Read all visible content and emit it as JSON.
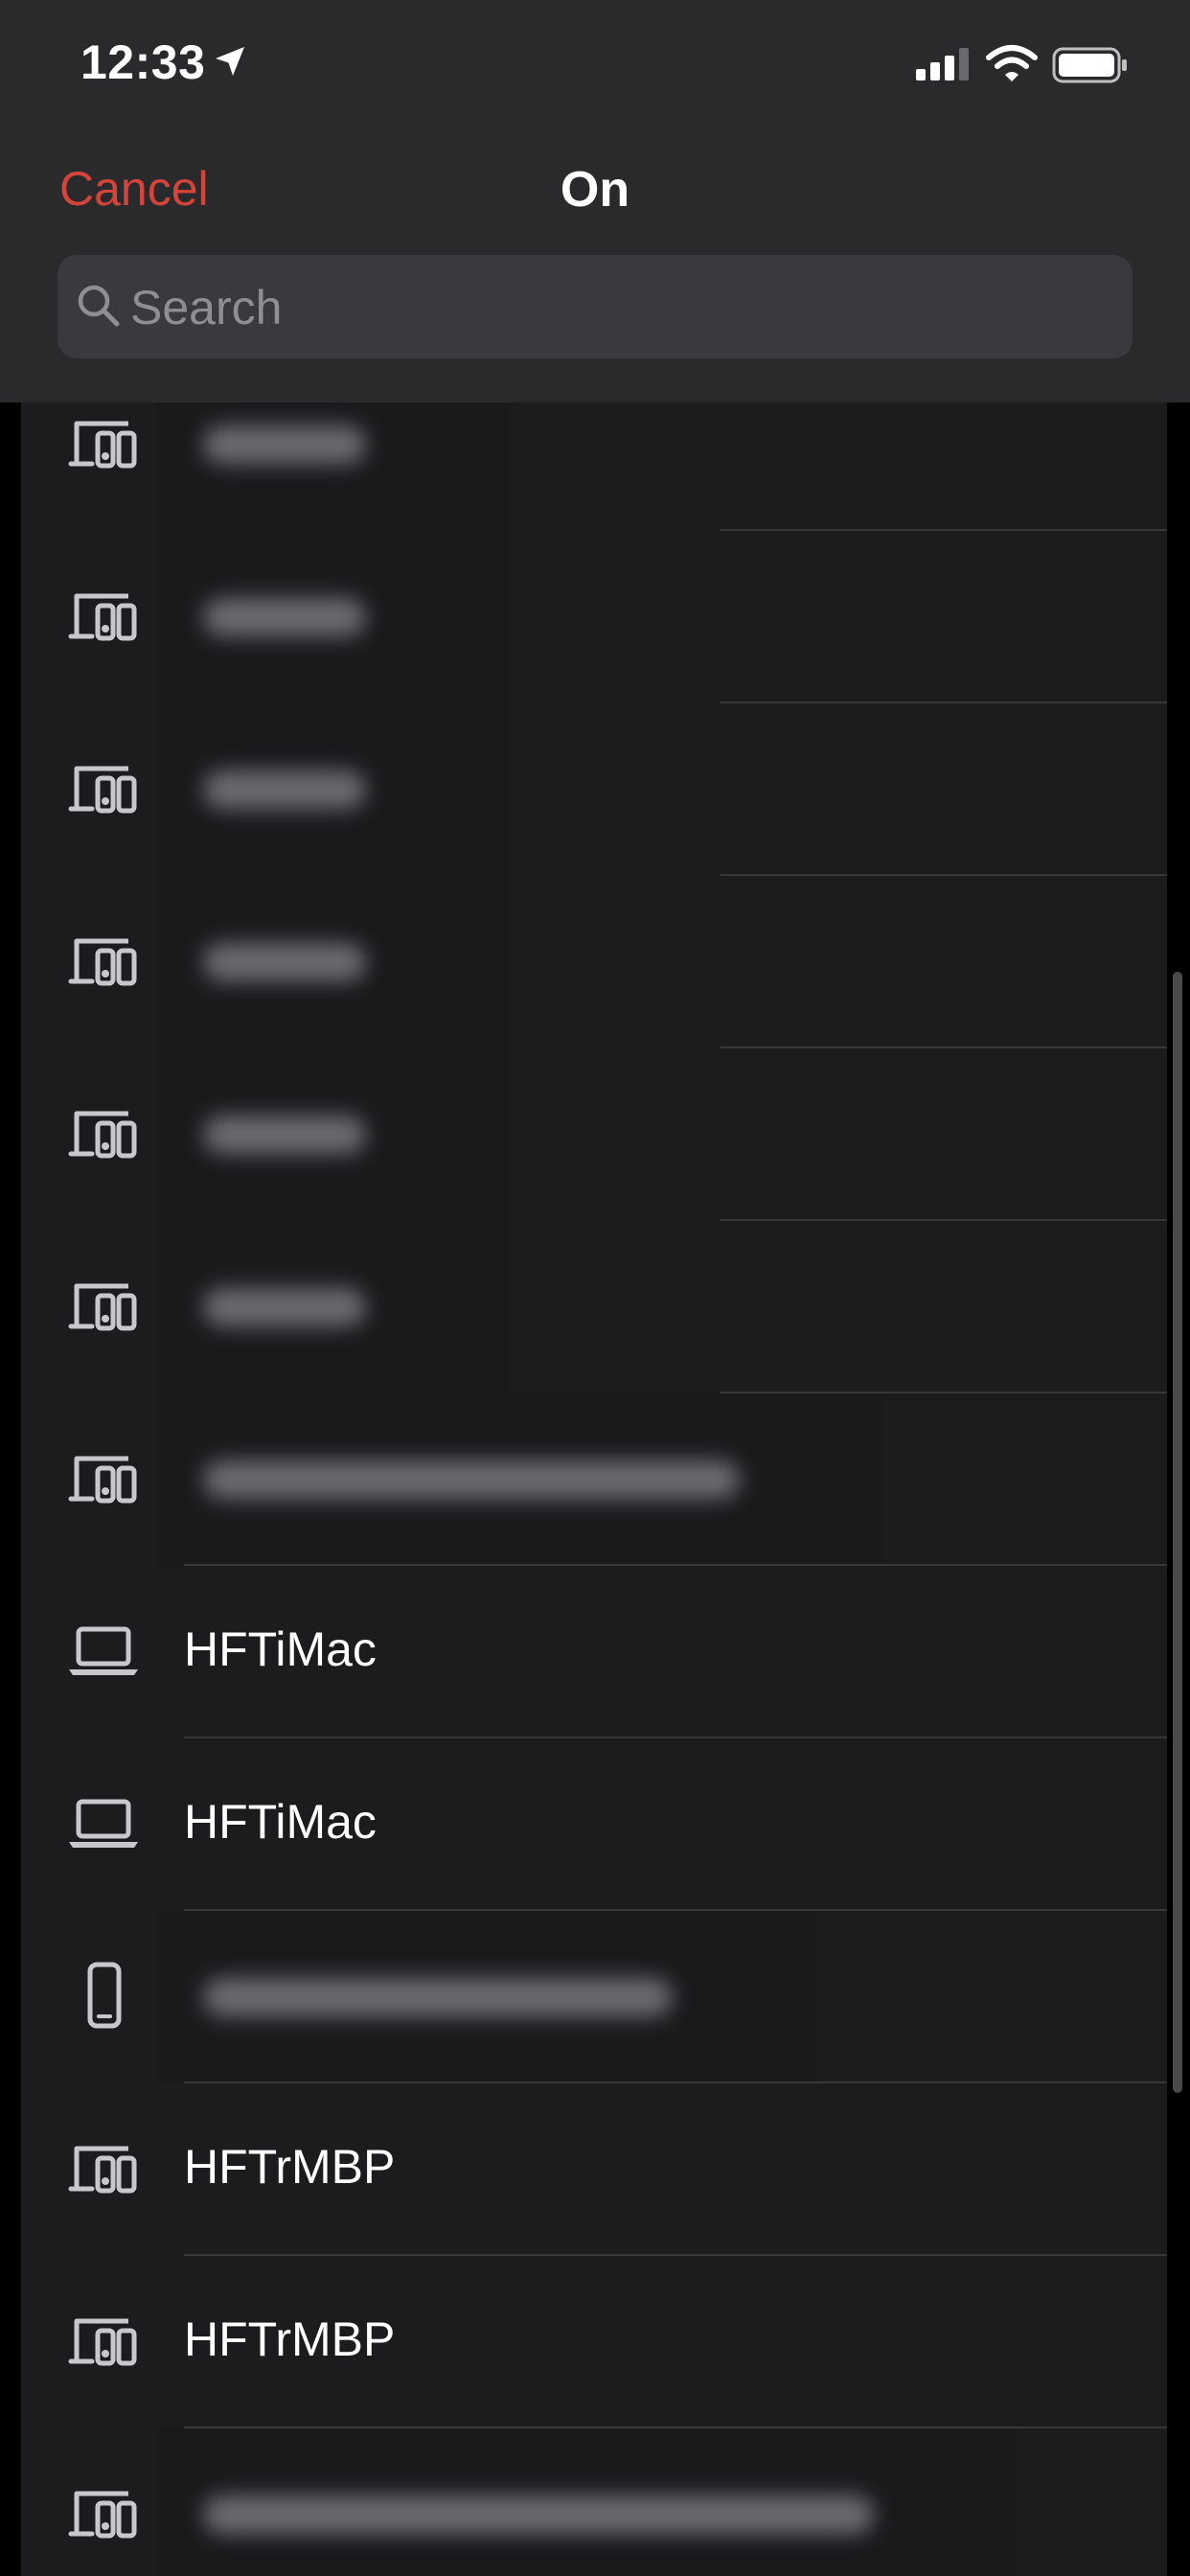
{
  "status_bar": {
    "time": "12:33",
    "icons": [
      "location-arrow-icon",
      "cellular-signal-icon",
      "wifi-icon",
      "battery-icon"
    ]
  },
  "nav": {
    "cancel_label": "Cancel",
    "title": "On"
  },
  "search": {
    "placeholder": "Search",
    "value": ""
  },
  "colors": {
    "accent": "#d5443a",
    "background": "#1c1c1f",
    "header": "#2a2a2d"
  },
  "devices": [
    {
      "icon": "devices-icon",
      "label": "",
      "redacted": true
    },
    {
      "icon": "devices-icon",
      "label": "",
      "redacted": true
    },
    {
      "icon": "devices-icon",
      "label": "",
      "redacted": true
    },
    {
      "icon": "devices-icon",
      "label": "",
      "redacted": true
    },
    {
      "icon": "devices-icon",
      "label": "",
      "redacted": true
    },
    {
      "icon": "devices-icon",
      "label": "",
      "redacted": true
    },
    {
      "icon": "devices-icon",
      "label": "",
      "redacted": true
    },
    {
      "icon": "laptop-icon",
      "label": "HFTiMac",
      "redacted": false
    },
    {
      "icon": "laptop-icon",
      "label": "HFTiMac",
      "redacted": false
    },
    {
      "icon": "phone-icon",
      "label": "",
      "redacted": true
    },
    {
      "icon": "devices-icon",
      "label": "HFTrMBP",
      "redacted": false
    },
    {
      "icon": "devices-icon",
      "label": "HFTrMBP",
      "redacted": false
    },
    {
      "icon": "devices-icon",
      "label": "",
      "redacted": true
    }
  ]
}
